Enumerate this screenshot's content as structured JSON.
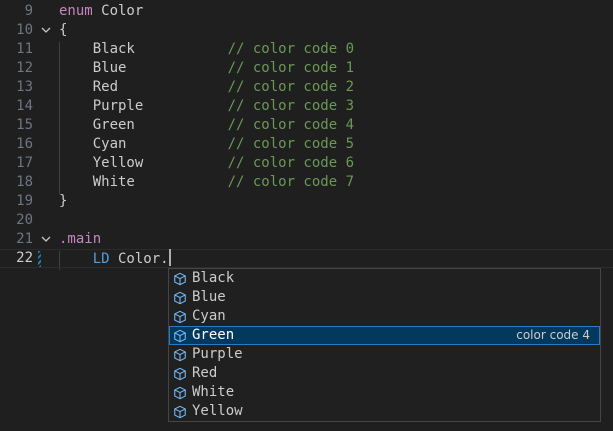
{
  "lines": [
    {
      "num": "9",
      "fold": false,
      "parts": [
        {
          "cls": "kw",
          "text": "enum"
        },
        {
          "cls": "ident",
          "text": " Color"
        }
      ]
    },
    {
      "num": "10",
      "fold": true,
      "parts": [
        {
          "cls": "ident",
          "text": "{"
        }
      ]
    },
    {
      "num": "11",
      "fold": false,
      "parts": [
        {
          "cls": "ident",
          "text": "    Black           "
        },
        {
          "cls": "comment",
          "text": "// color code 0"
        }
      ]
    },
    {
      "num": "12",
      "fold": false,
      "parts": [
        {
          "cls": "ident",
          "text": "    Blue            "
        },
        {
          "cls": "comment",
          "text": "// color code 1"
        }
      ]
    },
    {
      "num": "13",
      "fold": false,
      "parts": [
        {
          "cls": "ident",
          "text": "    Red             "
        },
        {
          "cls": "comment",
          "text": "// color code 2"
        }
      ]
    },
    {
      "num": "14",
      "fold": false,
      "parts": [
        {
          "cls": "ident",
          "text": "    Purple          "
        },
        {
          "cls": "comment",
          "text": "// color code 3"
        }
      ]
    },
    {
      "num": "15",
      "fold": false,
      "parts": [
        {
          "cls": "ident",
          "text": "    Green           "
        },
        {
          "cls": "comment",
          "text": "// color code 4"
        }
      ]
    },
    {
      "num": "16",
      "fold": false,
      "parts": [
        {
          "cls": "ident",
          "text": "    Cyan            "
        },
        {
          "cls": "comment",
          "text": "// color code 5"
        }
      ]
    },
    {
      "num": "17",
      "fold": false,
      "parts": [
        {
          "cls": "ident",
          "text": "    Yellow          "
        },
        {
          "cls": "comment",
          "text": "// color code 6"
        }
      ]
    },
    {
      "num": "18",
      "fold": false,
      "parts": [
        {
          "cls": "ident",
          "text": "    White           "
        },
        {
          "cls": "comment",
          "text": "// color code 7"
        }
      ]
    },
    {
      "num": "19",
      "fold": false,
      "parts": [
        {
          "cls": "ident",
          "text": "}"
        }
      ]
    },
    {
      "num": "20",
      "fold": false,
      "parts": []
    },
    {
      "num": "21",
      "fold": true,
      "parts": [
        {
          "cls": "label",
          "text": ".main"
        }
      ]
    },
    {
      "num": "22",
      "fold": false,
      "current": true,
      "parts": [
        {
          "cls": "ident",
          "text": "    "
        },
        {
          "cls": "instr",
          "text": "LD"
        },
        {
          "cls": "ident",
          "text": " Color."
        }
      ]
    }
  ],
  "suggestions": [
    {
      "label": "Black",
      "detail": "",
      "icon": "enum-member-icon"
    },
    {
      "label": "Blue",
      "detail": "",
      "icon": "enum-member-icon"
    },
    {
      "label": "Cyan",
      "detail": "",
      "icon": "enum-member-icon"
    },
    {
      "label": "Green",
      "detail": "color code 4",
      "icon": "enum-member-icon",
      "selected": true
    },
    {
      "label": "Purple",
      "detail": "",
      "icon": "enum-member-icon"
    },
    {
      "label": "Red",
      "detail": "",
      "icon": "enum-member-icon"
    },
    {
      "label": "White",
      "detail": "",
      "icon": "enum-member-icon"
    },
    {
      "label": "Yellow",
      "detail": "",
      "icon": "enum-member-icon"
    }
  ],
  "colors": {
    "background": "#1f1f1f",
    "keyword": "#c586c0",
    "comment": "#6a9955",
    "instruction": "#569cd6",
    "selection": "#04395e",
    "icon": "#75beff"
  }
}
